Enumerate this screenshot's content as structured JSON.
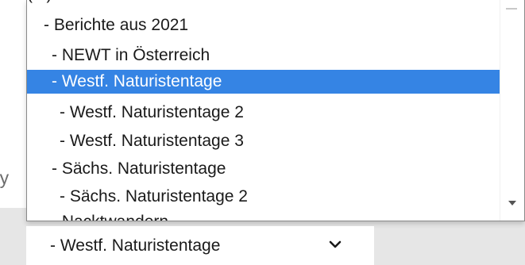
{
  "background": {
    "partial_text": "ry"
  },
  "dropdown": {
    "clipped_top_label": "(...)",
    "items": [
      {
        "label": "- Berichte aus 2021",
        "selected": false
      },
      {
        "label": "- NEWT in Österreich",
        "selected": false
      },
      {
        "label": "- Westf. Naturistentage",
        "selected": true
      },
      {
        "label": "- Westf. Naturistentage 2",
        "selected": false
      },
      {
        "label": "- Westf. Naturistentage 3",
        "selected": false
      },
      {
        "label": "- Sächs. Naturistentage",
        "selected": false
      },
      {
        "label": "- Sächs. Naturistentage 2",
        "selected": false
      },
      {
        "label": "- Nacktwandern",
        "selected": false
      }
    ]
  },
  "select": {
    "value": "- Westf. Naturistentage"
  },
  "colors": {
    "highlight": "#3584e4",
    "text": "#1a1a1a",
    "selected_text": "#ffffff"
  },
  "icons": {
    "select_toggle": "chevron-down-icon",
    "scroll_down": "scroll-down-arrow-icon"
  }
}
